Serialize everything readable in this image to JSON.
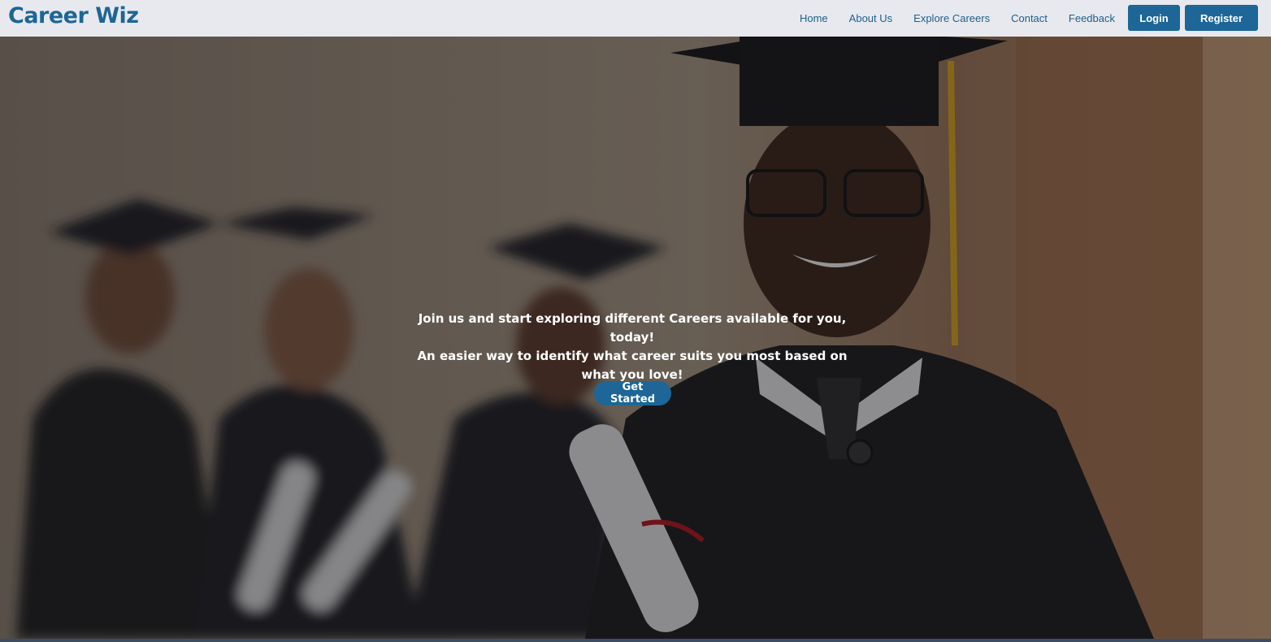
{
  "brand": {
    "name": "Career Wiz"
  },
  "nav": {
    "links": [
      "Home",
      "About Us",
      "Explore Careers",
      "Contact",
      "Feedback"
    ],
    "login_label": "Login",
    "register_label": "Register"
  },
  "hero": {
    "line1": "Join us and start exploring different Careers available for you, today!",
    "line2": "An easier way to identify what career suits you most based on what you love!",
    "cta_label": "Get Started"
  },
  "colors": {
    "accent": "#1d6697",
    "navbar_bg": "#e8e9ee",
    "hero_text": "#ffffff"
  }
}
